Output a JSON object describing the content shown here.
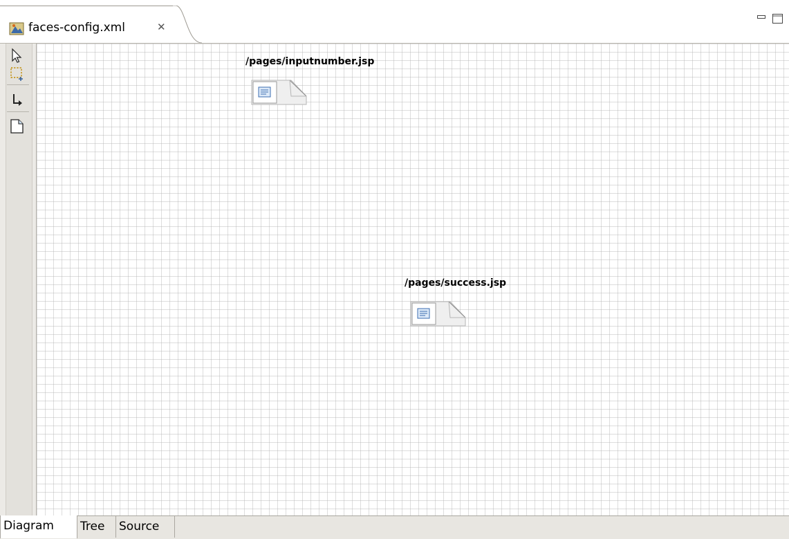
{
  "editor": {
    "tab_title": "faces-config.xml",
    "tab_icon": "faces-config-file-icon",
    "close_glyph": "✕"
  },
  "palette": {
    "tools": [
      {
        "name": "select-tool",
        "icon": "arrow-pointer-icon"
      },
      {
        "name": "marquee-tool",
        "icon": "marquee-selection-icon"
      },
      {
        "name": "create-navigation-rule-tool",
        "icon": "navigation-connection-icon"
      },
      {
        "name": "create-page-tool",
        "icon": "new-page-icon"
      }
    ]
  },
  "diagram": {
    "nodes": [
      {
        "label": "/pages/inputnumber.jsp",
        "icon": "jsp-page-icon"
      },
      {
        "label": "/pages/success.jsp",
        "icon": "jsp-page-icon"
      }
    ]
  },
  "page_tabs": {
    "items": [
      "Diagram",
      "Tree",
      "Source"
    ],
    "active": "Diagram"
  }
}
